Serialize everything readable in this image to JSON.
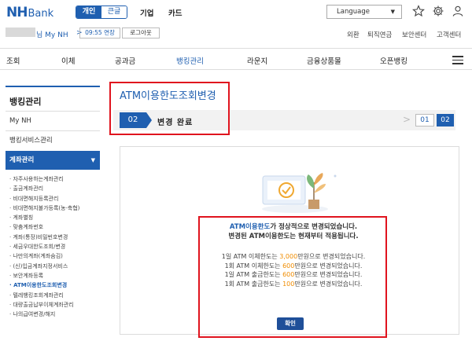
{
  "header": {
    "logo_nh": "NH",
    "logo_bank": "Bank",
    "segment": {
      "personal": "개인",
      "corporate": "큰글"
    },
    "links": [
      "기업",
      "카드"
    ],
    "language": "Language"
  },
  "user": {
    "name": "님 My NH",
    "timer": "09:55 연장",
    "logout": "로그아웃"
  },
  "util_links": [
    "외환",
    "퇴직연금",
    "보안센터",
    "고객센터"
  ],
  "gnb": [
    "조회",
    "이체",
    "공과금",
    "뱅킹관리",
    "라운지",
    "금융상품몰",
    "오픈뱅킹"
  ],
  "gnb_active": "뱅킹관리",
  "sidebar": {
    "title": "뱅킹관리",
    "items": [
      "My NH",
      "뱅킹서비스관리"
    ],
    "selected": "계좌관리",
    "sub_items": [
      "· 자주사용하는계좌관리",
      "· 출금계좌관리",
      "· 비대면해지등록관리",
      "· 비대면해지불가등록(농·축협)",
      "· 계좌별칭",
      "· 맞춤계좌번호",
      "· 계좌(통장)비밀번호변경",
      "· 세금우대한도조회/변경",
      "· 나만의계좌(계좌숨김)",
      "· (신)입금계좌지정서비스",
      "· 보안계좌등록",
      "· ATM이용한도조회변경",
      "· 텔레뱅킹조회계좌관리",
      "· 대량출금납부이체계좌관리",
      "· 나의급여변경/해지"
    ],
    "active_sub": "· ATM이용한도조회변경"
  },
  "page": {
    "title": "ATM이용한도조회변경",
    "step_num": "02",
    "step_label": "변경 완료",
    "steps": [
      "01",
      "02"
    ]
  },
  "result": {
    "line1_hl": "ATM이용한도",
    "line1_rest": "가 정상적으로 변경되었습니다.",
    "line2": "변경된 ATM이용한도는 현재부터 적용됩니다.",
    "limits": [
      {
        "pre": "1일 ATM 이체한도는 ",
        "amt": "3,000",
        "post": "만원으로 변경되었습니다."
      },
      {
        "pre": "1회 ATM 이체한도는 ",
        "amt": "600",
        "post": "만원으로 변경되었습니다."
      },
      {
        "pre": "1일 ATM 출금한도는 ",
        "amt": "600",
        "post": "만원으로 변경되었습니다."
      },
      {
        "pre": "1회 ATM 출금한도는 ",
        "amt": "100",
        "post": "만원으로 변경되었습니다."
      }
    ],
    "confirm": "확인"
  },
  "colors": {
    "brand": "#1f5fb0",
    "highlight": "#f08c00",
    "annotation": "#e0141e"
  }
}
